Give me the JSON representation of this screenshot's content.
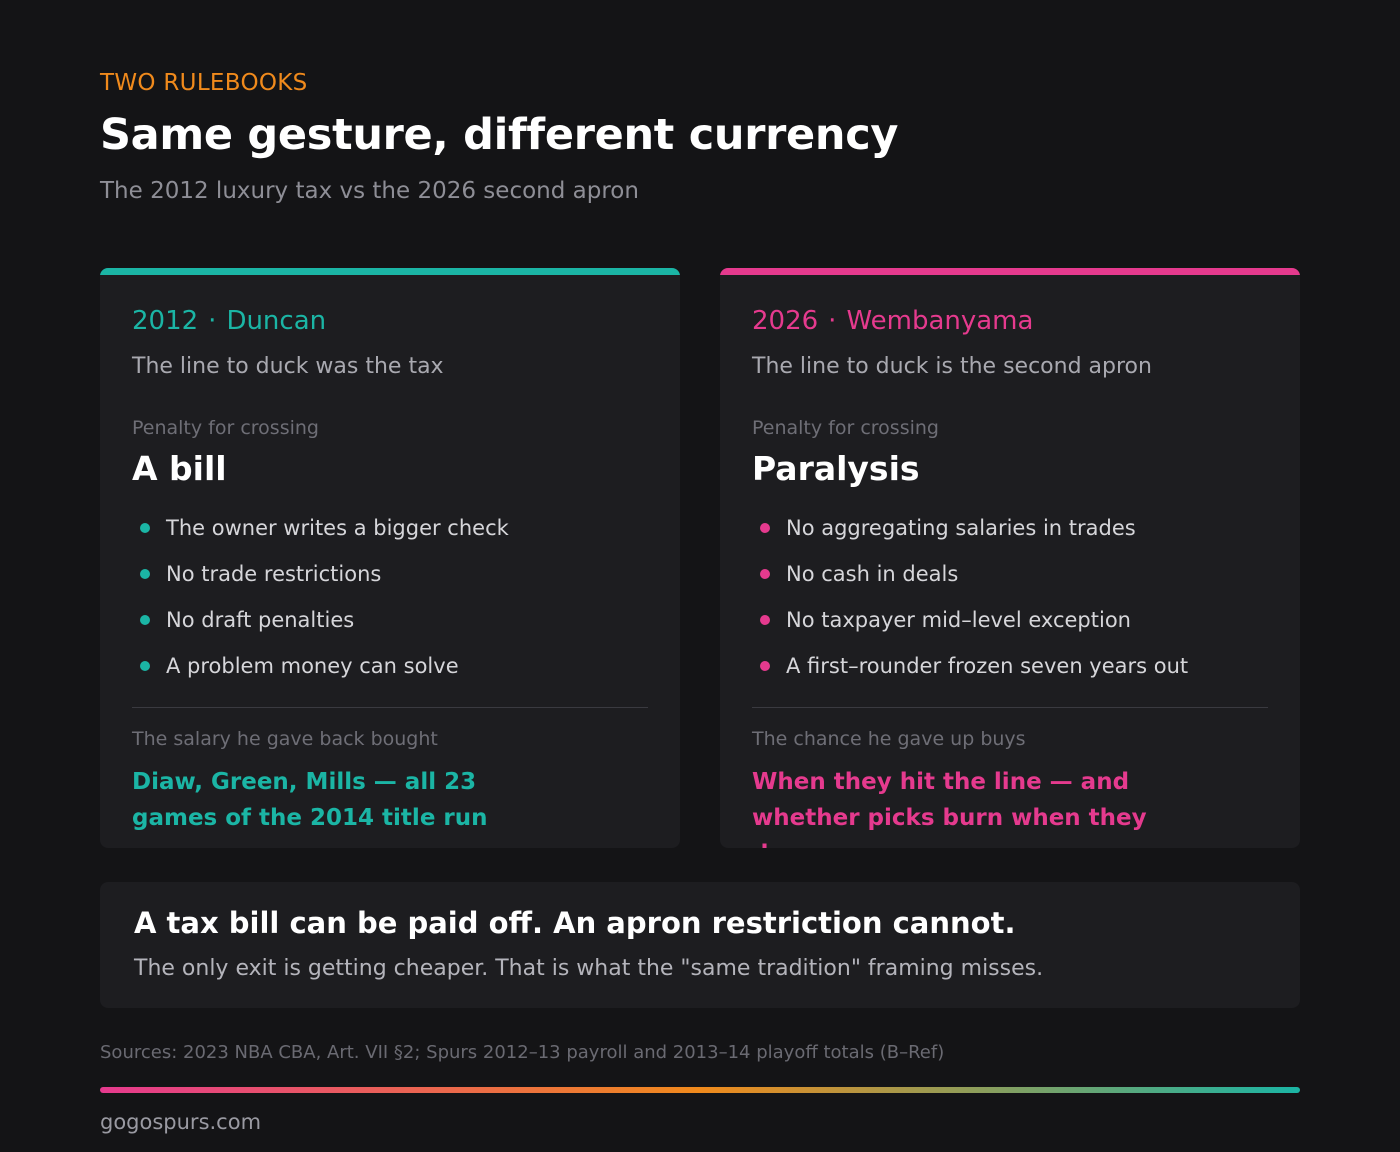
{
  "header": {
    "eyebrow": "TWO RULEBOOKS",
    "title": "Same gesture, different currency",
    "subtitle": "The 2012 luxury tax vs the 2026 second apron"
  },
  "cards": [
    {
      "year": "2012",
      "separator": "·",
      "name": "Duncan",
      "line": "The line to duck was the tax",
      "penalty_label": "Penalty for crossing",
      "penalty": "A bill",
      "bullets": [
        "The owner writes a bigger check",
        "No trade restrictions",
        "No draft penalties",
        "A problem money can solve"
      ],
      "foot_label": "The salary he gave back bought",
      "foot_value": "Diaw, Green, Mills — all 23 games of the 2014 title run",
      "accent": "#1bb5a5"
    },
    {
      "year": "2026",
      "separator": "·",
      "name": "Wembanyama",
      "line": "The line to duck is the second apron",
      "penalty_label": "Penalty for crossing",
      "penalty": "Paralysis",
      "bullets": [
        "No aggregating salaries in trades",
        "No cash in deals",
        "No taxpayer mid–level exception",
        "A first–rounder frozen seven years out"
      ],
      "foot_label": "The chance he gave up buys",
      "foot_value": "When they hit the line — and whether picks burn when they do",
      "accent": "#e53a8e"
    }
  ],
  "callout": {
    "title": "A tax bill can be paid off. An apron restriction cannot.",
    "body": "The only exit is getting cheaper. That is what the \"same tradition\" framing misses."
  },
  "footer": {
    "sources": "Sources: 2023 NBA CBA, Art. VII §2; Spurs 2012–13 payroll and 2013–14 playoff totals (B–Ref)",
    "brand": "gogospurs.com"
  },
  "colors": {
    "eyebrow": "#f08a1c",
    "teal": "#1bb5a5",
    "pink": "#e53a8e",
    "background": "#141416",
    "card": "#1d1d20"
  }
}
